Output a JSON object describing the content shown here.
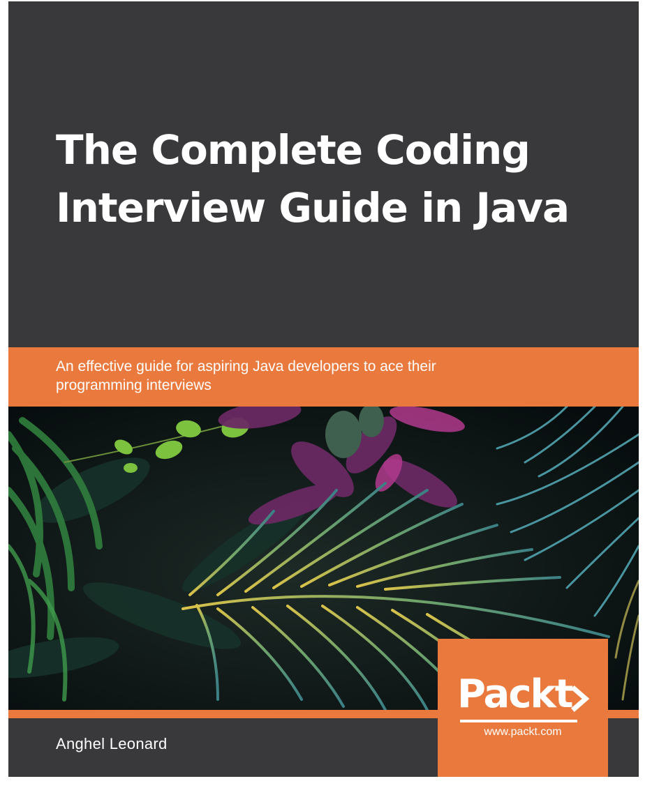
{
  "cover": {
    "title_lines": [
      "The Complete Coding",
      "Interview Guide in Java"
    ],
    "subtitle_lines": [
      "An effective guide for aspiring Java developers to ace their",
      "programming interviews"
    ],
    "author": "Anghel Leonard",
    "publisher": {
      "logo_text": "Packt",
      "url": "www.packt.com"
    }
  },
  "colors": {
    "background": "#39393b",
    "accent": "#e9793d",
    "text": "#ffffff"
  },
  "icons": {
    "publisher_logo": "packt-logo-icon",
    "photo": "tropical-foliage-photo"
  }
}
